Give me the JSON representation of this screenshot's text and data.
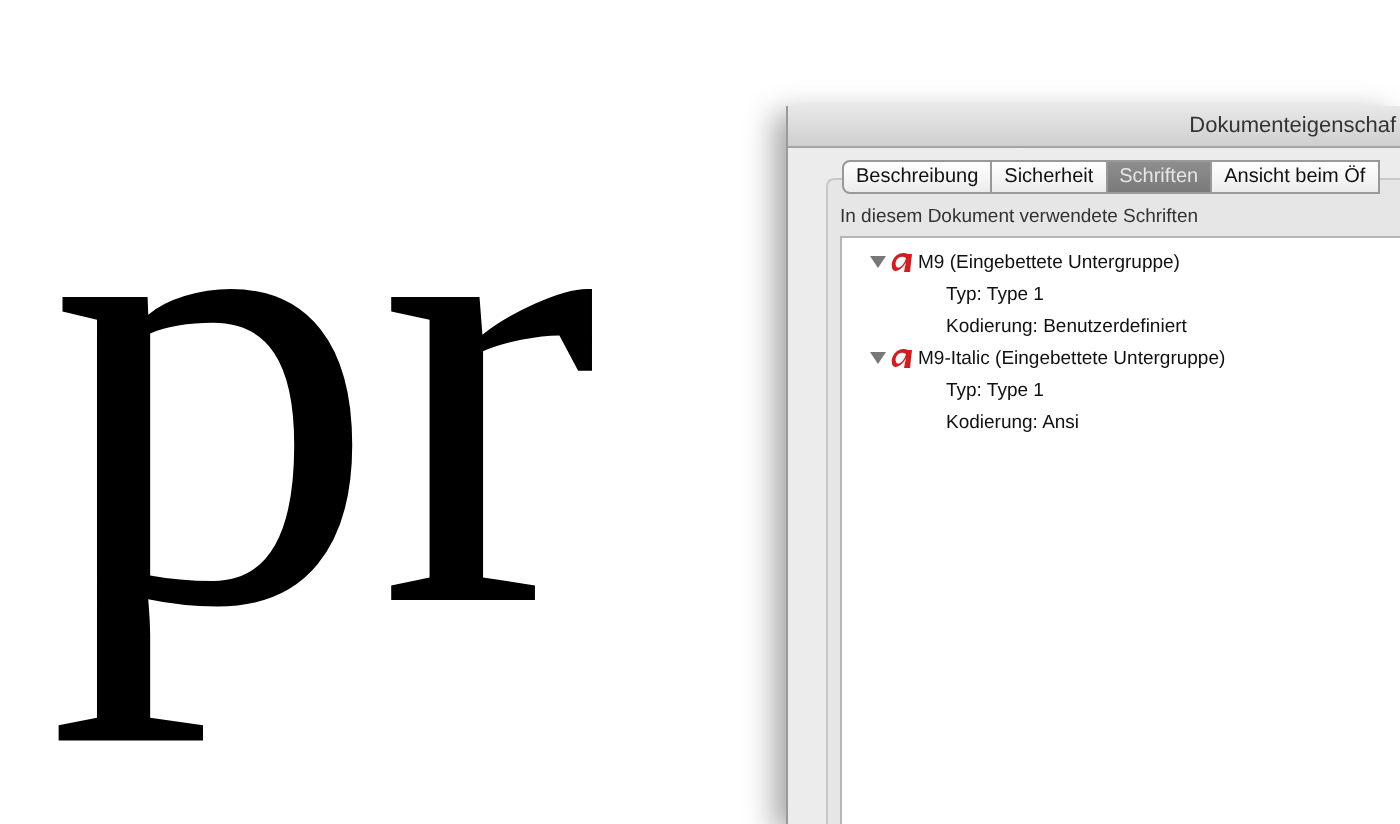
{
  "background": {
    "text": "pr"
  },
  "dialog": {
    "title": "Dokumenteigenschaf",
    "tabs": [
      {
        "label": "Beschreibung",
        "selected": false
      },
      {
        "label": "Sicherheit",
        "selected": false
      },
      {
        "label": "Schriften",
        "selected": true
      },
      {
        "label": "Ansicht beim Öf",
        "selected": false
      }
    ],
    "group_label": "In diesem Dokument verwendete Schriften",
    "fonts": [
      {
        "name": "M9 (Eingebettete Untergruppe)",
        "expanded": true,
        "children": [
          {
            "text": "Typ: Type 1"
          },
          {
            "text": "Kodierung: Benutzerdefiniert"
          }
        ]
      },
      {
        "name": "M9-Italic (Eingebettete Untergruppe)",
        "expanded": true,
        "children": [
          {
            "text": "Typ: Type 1"
          },
          {
            "text": "Kodierung: Ansi"
          }
        ]
      }
    ]
  }
}
